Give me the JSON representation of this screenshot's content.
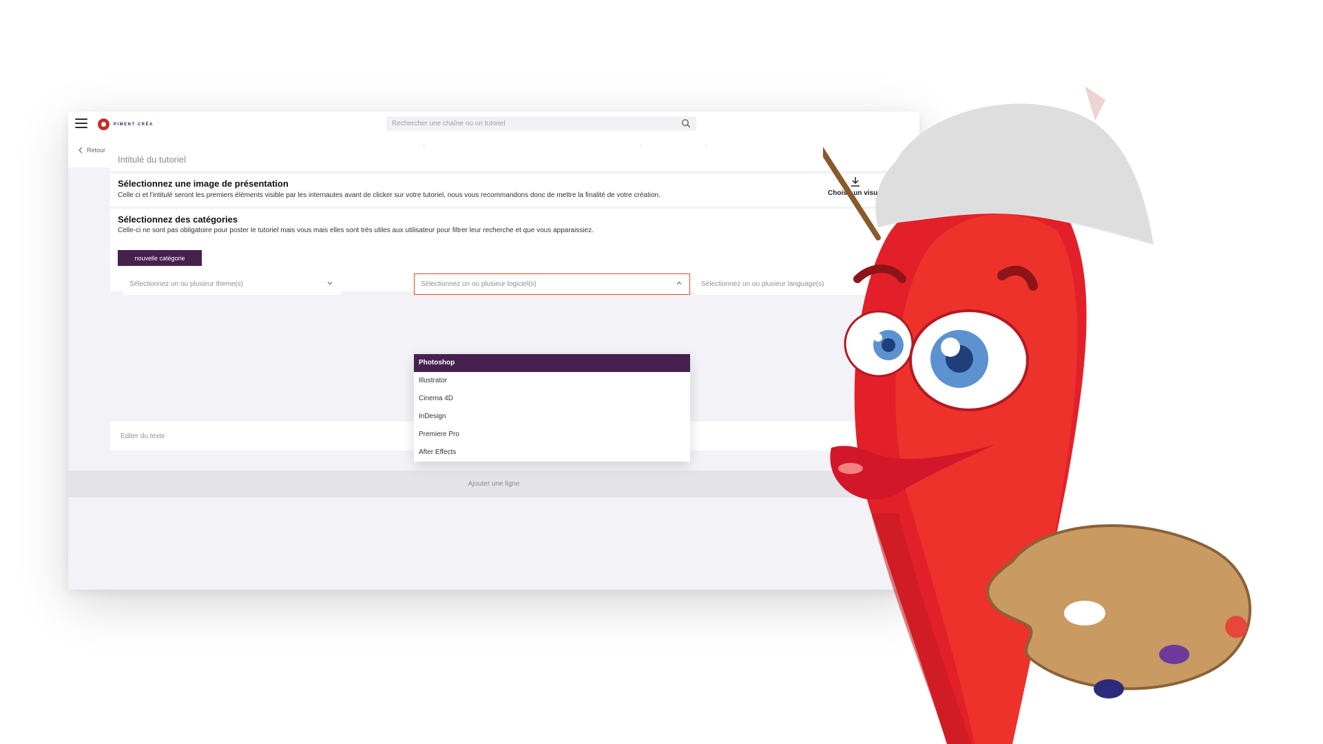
{
  "header": {
    "logo_text": "PIMENT CRÉA",
    "search_placeholder": "Rechercher une chaîne ou un tutoriel"
  },
  "toolbar": {
    "back_label": "Retour",
    "tools": [
      "undo-icon",
      "redo-icon",
      "bold-icon",
      "italic-icon",
      "font-color-icon",
      "strikethrough-icon",
      "clear-format-icon",
      "superscript-icon",
      "subscript-icon",
      "bullet-list-icon",
      "align-icon",
      "image-icon"
    ]
  },
  "form": {
    "title_placeholder": "Intitulé du tutoriel",
    "image_section": {
      "heading": "Sélectionnez une image de présentation",
      "description": "Celle ci et l'intitulé seront les premiers éléments visible par les internautes avant de clicker sur votre tutoriel, nous vous recommandons donc de mettre la finalité de votre création.",
      "download_label": "Choisir un visuel"
    },
    "category_section": {
      "heading": "Sélectionnez des catégories",
      "description": "Celle-ci ne sont pas obligatoire pour poster le tutoriel mais vous mais elles sont très utiles aux utilisateur pour filtrer leur recherche et que vous apparaissiez.",
      "new_category_button": "nouvelle catégorie",
      "select_themes": "Sélectionnez un ou plusieur theme(s)",
      "select_software": "Sélectionnez un ou plusieur logiciel(s)",
      "select_languages": "Sélectionnez un ou plusieur language(s)"
    },
    "software_options": [
      "Photoshop",
      "Illustrator",
      "Cinema 4D",
      "InDesign",
      "Premiere Pro",
      "After Effects"
    ],
    "text_placeholder": "Éditer du texte",
    "add_line_label": "Ajouter une ligne"
  },
  "colors": {
    "accent": "#46204f",
    "focus_border": "#d94b2b",
    "background": "#f2f2f7"
  }
}
